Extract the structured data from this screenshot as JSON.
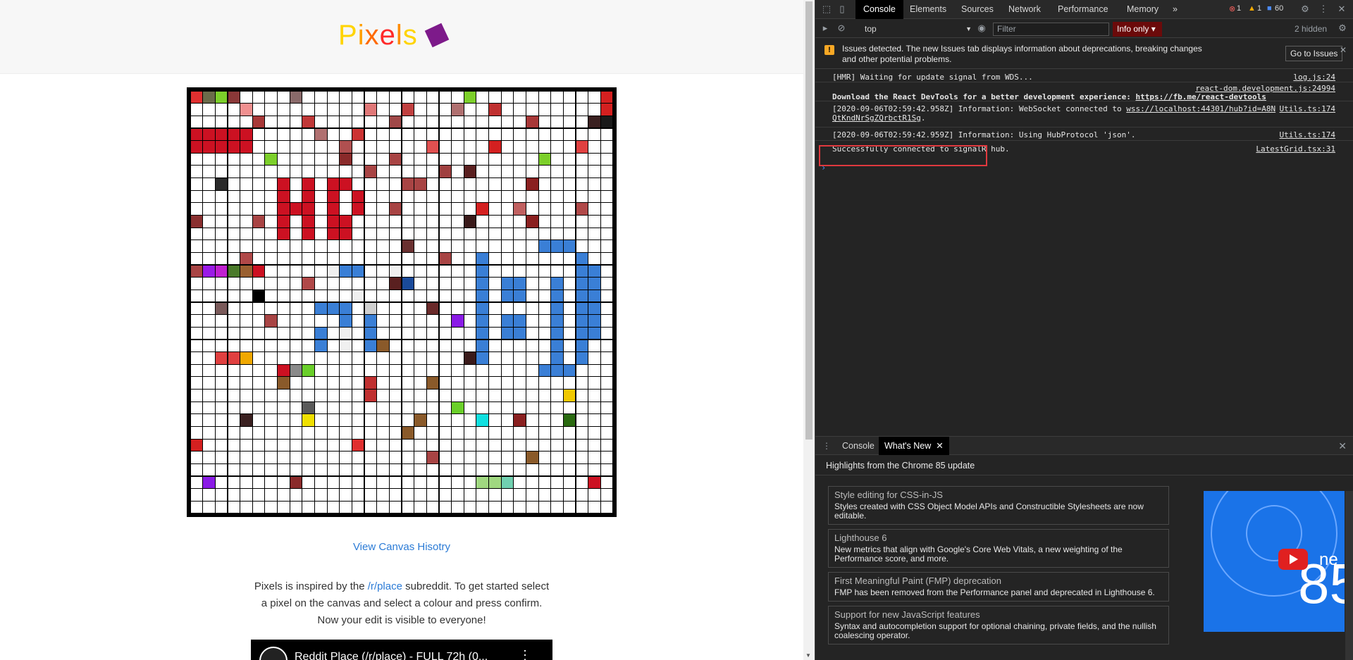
{
  "page": {
    "logo_letters": [
      {
        "ch": "P",
        "color": "#ffd400"
      },
      {
        "ch": "i",
        "color": "#ff9f00"
      },
      {
        "ch": "x",
        "color": "#ff6a00"
      },
      {
        "ch": "e",
        "color": "#ff2a2a"
      },
      {
        "ch": "l",
        "color": "#ff8c00"
      },
      {
        "ch": "s",
        "color": "#ffd400"
      }
    ],
    "history_link": "View Canvas Hisotry",
    "description_1": "Pixels is inspired by the ",
    "description_link": "/r/place",
    "description_2": " subreddit. To get started select a pixel on the canvas and select a colour and press confirm. Now your edit is visible to everyone!",
    "video_title": "Reddit Place (/r/place) - FULL 72h (0..."
  },
  "grid": {
    "size": 34,
    "cells": [
      [
        0,
        0,
        "#e03030"
      ],
      [
        1,
        0,
        "#6b6b4a"
      ],
      [
        2,
        0,
        "#7ccf2a"
      ],
      [
        3,
        0,
        "#8a3838"
      ],
      [
        8,
        0,
        "#8a6a6a"
      ],
      [
        22,
        0,
        "#7ccf2a"
      ],
      [
        33,
        0,
        "#d42020"
      ],
      [
        4,
        1,
        "#f09090"
      ],
      [
        17,
        1,
        "#c04040"
      ],
      [
        14,
        1,
        "#e07878"
      ],
      [
        21,
        1,
        "#b07070"
      ],
      [
        24,
        1,
        "#c03030"
      ],
      [
        33,
        1,
        "#d42020"
      ],
      [
        5,
        2,
        "#a83838"
      ],
      [
        9,
        2,
        "#c03838"
      ],
      [
        16,
        2,
        "#a04848"
      ],
      [
        27,
        2,
        "#a83838"
      ],
      [
        32,
        2,
        "#3a2020"
      ],
      [
        33,
        2,
        "#1a1a1a"
      ],
      [
        0,
        3,
        "#cc1122"
      ],
      [
        1,
        3,
        "#cc1122"
      ],
      [
        2,
        3,
        "#cc1122"
      ],
      [
        3,
        3,
        "#cc1122"
      ],
      [
        4,
        3,
        "#cc1122"
      ],
      [
        10,
        3,
        "#b07070"
      ],
      [
        13,
        3,
        "#cc3333"
      ],
      [
        0,
        4,
        "#cc1122"
      ],
      [
        1,
        4,
        "#cc1122"
      ],
      [
        2,
        4,
        "#cc1122"
      ],
      [
        3,
        4,
        "#cc1122"
      ],
      [
        4,
        4,
        "#cc1122"
      ],
      [
        12,
        4,
        "#b05050"
      ],
      [
        19,
        4,
        "#e05050"
      ],
      [
        24,
        4,
        "#d42020"
      ],
      [
        31,
        4,
        "#e04040"
      ],
      [
        6,
        5,
        "#7ccf2a"
      ],
      [
        12,
        5,
        "#8a2a2a"
      ],
      [
        16,
        5,
        "#a84444"
      ],
      [
        28,
        5,
        "#7ccf2a"
      ],
      [
        22,
        6,
        "#5a2020"
      ],
      [
        20,
        6,
        "#a04040"
      ],
      [
        14,
        6,
        "#a84444"
      ],
      [
        2,
        7,
        "#2a2a2a"
      ],
      [
        7,
        7,
        "#cc1122"
      ],
      [
        9,
        7,
        "#cc1122"
      ],
      [
        11,
        7,
        "#cc1122"
      ],
      [
        12,
        7,
        "#cc1122"
      ],
      [
        17,
        7,
        "#a84444"
      ],
      [
        18,
        7,
        "#a84444"
      ],
      [
        27,
        7,
        "#8a2020"
      ],
      [
        7,
        8,
        "#cc1122"
      ],
      [
        9,
        8,
        "#cc1122"
      ],
      [
        11,
        8,
        "#cc1122"
      ],
      [
        13,
        8,
        "#cc1122"
      ],
      [
        7,
        9,
        "#cc1122"
      ],
      [
        8,
        9,
        "#cc1122"
      ],
      [
        9,
        9,
        "#cc1122"
      ],
      [
        11,
        9,
        "#cc1122"
      ],
      [
        13,
        9,
        "#cc1122"
      ],
      [
        16,
        9,
        "#a84444"
      ],
      [
        23,
        9,
        "#d42020"
      ],
      [
        26,
        9,
        "#c06060"
      ],
      [
        31,
        9,
        "#b04848"
      ],
      [
        0,
        10,
        "#8a3030"
      ],
      [
        5,
        10,
        "#a84444"
      ],
      [
        7,
        10,
        "#cc1122"
      ],
      [
        9,
        10,
        "#cc1122"
      ],
      [
        11,
        10,
        "#cc1122"
      ],
      [
        12,
        10,
        "#cc1122"
      ],
      [
        22,
        10,
        "#3a1a1a"
      ],
      [
        27,
        10,
        "#8a2020"
      ],
      [
        7,
        11,
        "#cc1122"
      ],
      [
        9,
        11,
        "#cc1122"
      ],
      [
        11,
        11,
        "#cc1122"
      ],
      [
        12,
        11,
        "#cc1122"
      ],
      [
        17,
        12,
        "#6a3030"
      ],
      [
        28,
        12,
        "#3a7fd6"
      ],
      [
        29,
        12,
        "#3a7fd6"
      ],
      [
        30,
        12,
        "#3a7fd6"
      ],
      [
        4,
        13,
        "#b04848"
      ],
      [
        20,
        13,
        "#a84444"
      ],
      [
        23,
        13,
        "#3a7fd6"
      ],
      [
        31,
        13,
        "#3a7fd6"
      ],
      [
        0,
        14,
        "#a84444"
      ],
      [
        1,
        14,
        "#9a1ae6"
      ],
      [
        2,
        14,
        "#c020d0"
      ],
      [
        3,
        14,
        "#4a7a2a"
      ],
      [
        4,
        14,
        "#9a6030"
      ],
      [
        5,
        14,
        "#cc1122"
      ],
      [
        11,
        14,
        "#f0f0f0"
      ],
      [
        12,
        14,
        "#3a7fd6"
      ],
      [
        13,
        14,
        "#3a7fd6"
      ],
      [
        16,
        14,
        "#f0f0f0"
      ],
      [
        23,
        14,
        "#3a7fd6"
      ],
      [
        31,
        14,
        "#3a7fd6"
      ],
      [
        32,
        14,
        "#3a7fd6"
      ],
      [
        9,
        15,
        "#b04848"
      ],
      [
        16,
        15,
        "#5a2020"
      ],
      [
        17,
        15,
        "#1a4a9a"
      ],
      [
        23,
        15,
        "#3a7fd6"
      ],
      [
        25,
        15,
        "#3a7fd6"
      ],
      [
        26,
        15,
        "#3a7fd6"
      ],
      [
        29,
        15,
        "#3a7fd6"
      ],
      [
        31,
        15,
        "#3a7fd6"
      ],
      [
        32,
        15,
        "#3a7fd6"
      ],
      [
        5,
        16,
        "#000000"
      ],
      [
        13,
        16,
        "#f0f0f0"
      ],
      [
        23,
        16,
        "#3a7fd6"
      ],
      [
        25,
        16,
        "#3a7fd6"
      ],
      [
        26,
        16,
        "#3a7fd6"
      ],
      [
        29,
        16,
        "#3a7fd6"
      ],
      [
        31,
        16,
        "#3a7fd6"
      ],
      [
        32,
        16,
        "#3a7fd6"
      ],
      [
        2,
        17,
        "#7a5a5a"
      ],
      [
        10,
        17,
        "#3a7fd6"
      ],
      [
        11,
        17,
        "#3a7fd6"
      ],
      [
        12,
        17,
        "#3a7fd6"
      ],
      [
        14,
        17,
        "#d0d0d0"
      ],
      [
        19,
        17,
        "#6a2a2a"
      ],
      [
        23,
        17,
        "#3a7fd6"
      ],
      [
        29,
        17,
        "#3a7fd6"
      ],
      [
        31,
        17,
        "#3a7fd6"
      ],
      [
        32,
        17,
        "#3a7fd6"
      ],
      [
        6,
        18,
        "#a84444"
      ],
      [
        12,
        18,
        "#3a7fd6"
      ],
      [
        14,
        18,
        "#3a7fd6"
      ],
      [
        21,
        18,
        "#8a1ae6"
      ],
      [
        23,
        18,
        "#3a7fd6"
      ],
      [
        25,
        18,
        "#3a7fd6"
      ],
      [
        26,
        18,
        "#3a7fd6"
      ],
      [
        29,
        18,
        "#3a7fd6"
      ],
      [
        31,
        18,
        "#3a7fd6"
      ],
      [
        32,
        18,
        "#3a7fd6"
      ],
      [
        10,
        19,
        "#3a7fd6"
      ],
      [
        12,
        19,
        "#f0f0f0"
      ],
      [
        14,
        19,
        "#3a7fd6"
      ],
      [
        23,
        19,
        "#3a7fd6"
      ],
      [
        25,
        19,
        "#3a7fd6"
      ],
      [
        26,
        19,
        "#3a7fd6"
      ],
      [
        29,
        19,
        "#3a7fd6"
      ],
      [
        31,
        19,
        "#3a7fd6"
      ],
      [
        32,
        19,
        "#3a7fd6"
      ],
      [
        10,
        20,
        "#3a7fd6"
      ],
      [
        12,
        20,
        "#f0f0f0"
      ],
      [
        14,
        20,
        "#3a7fd6"
      ],
      [
        15,
        20,
        "#8a5a2a"
      ],
      [
        23,
        20,
        "#3a7fd6"
      ],
      [
        29,
        20,
        "#3a7fd6"
      ],
      [
        31,
        20,
        "#3a7fd6"
      ],
      [
        2,
        21,
        "#e04040"
      ],
      [
        3,
        21,
        "#e04040"
      ],
      [
        4,
        21,
        "#f0a800"
      ],
      [
        22,
        21,
        "#3a1a1a"
      ],
      [
        23,
        21,
        "#3a7fd6"
      ],
      [
        29,
        21,
        "#3a7fd6"
      ],
      [
        31,
        21,
        "#3a7fd6"
      ],
      [
        7,
        22,
        "#cc1122"
      ],
      [
        8,
        22,
        "#8a8a8a"
      ],
      [
        9,
        22,
        "#6acf2a"
      ],
      [
        28,
        22,
        "#3a7fd6"
      ],
      [
        29,
        22,
        "#3a7fd6"
      ],
      [
        30,
        22,
        "#3a7fd6"
      ],
      [
        7,
        23,
        "#8a5a2a"
      ],
      [
        14,
        23,
        "#c03030"
      ],
      [
        19,
        23,
        "#8a5a2a"
      ],
      [
        14,
        24,
        "#c03030"
      ],
      [
        30,
        24,
        "#f0c800"
      ],
      [
        9,
        25,
        "#5a5a5a"
      ],
      [
        21,
        25,
        "#6acf2a"
      ],
      [
        4,
        26,
        "#3a2020"
      ],
      [
        9,
        26,
        "#f0e000"
      ],
      [
        18,
        26,
        "#8a5a2a"
      ],
      [
        23,
        26,
        "#10e0e0"
      ],
      [
        26,
        26,
        "#8a2020"
      ],
      [
        30,
        26,
        "#2a6a10"
      ],
      [
        17,
        27,
        "#8a5a2a"
      ],
      [
        0,
        28,
        "#d42020"
      ],
      [
        13,
        28,
        "#e03030"
      ],
      [
        19,
        29,
        "#a84444"
      ],
      [
        27,
        29,
        "#8a5a2a"
      ],
      [
        1,
        31,
        "#8a1ae6"
      ],
      [
        8,
        31,
        "#8a2a2a"
      ],
      [
        23,
        31,
        "#a0d880"
      ],
      [
        24,
        31,
        "#a0d880"
      ],
      [
        25,
        31,
        "#70d0b0"
      ],
      [
        32,
        31,
        "#cc1122"
      ]
    ]
  },
  "devtools": {
    "tabs": [
      "Console",
      "Elements",
      "Sources",
      "Network",
      "Performance",
      "Memory"
    ],
    "more_tabs": "»",
    "errors": "1",
    "warnings": "1",
    "messages": "60",
    "context": "top",
    "filter_placeholder": "Filter",
    "level": "Info only",
    "hidden": "2 hidden",
    "issues_text": "Issues detected. The new Issues tab displays information about deprecations, breaking changes and other potential problems.",
    "issues_button": "Go to Issues",
    "logs": [
      {
        "msg": "[HMR] Waiting for update signal from WDS...",
        "src": "log.js:24"
      },
      {
        "msg": "Download the React DevTools for a better development experience: ",
        "link": "https://fb.me/react-devtools",
        "src": "react-dom.development.js:24994"
      },
      {
        "msg": "[2020-09-06T02:59:42.958Z] Information: WebSocket connected to ",
        "link": "wss://localhost:44301/hub?id=A8N",
        "msg2": "QtKndNrSgZQrbctR1Sg",
        "src": "Utils.ts:174"
      },
      {
        "msg": "[2020-09-06T02:59:42.959Z] Information: Using HubProtocol 'json'.",
        "src": "Utils.ts:174"
      },
      {
        "msg": "Successfully connected to signalR hub.",
        "src": "LatestGrid.tsx:31"
      }
    ],
    "drawer_tabs": [
      "Console",
      "What's New"
    ],
    "whats_new_header": "Highlights from the Chrome 85 update",
    "features": [
      {
        "title": "Style editing for CSS-in-JS",
        "desc": "Styles created with CSS Object Model APIs and Constructible Stylesheets are now editable."
      },
      {
        "title": "Lighthouse 6",
        "desc": "New metrics that align with Google's Core Web Vitals, a new weighting of the Performance score, and more."
      },
      {
        "title": "First Meaningful Paint (FMP) deprecation",
        "desc": "FMP has been removed from the Performance panel and deprecated in Lighthouse 6."
      },
      {
        "title": "Support for new JavaScript features",
        "desc": "Syntax and autocompletion support for optional chaining, private fields, and the nullish coalescing operator."
      }
    ],
    "promo_text": "85",
    "promo_small": "ne"
  }
}
